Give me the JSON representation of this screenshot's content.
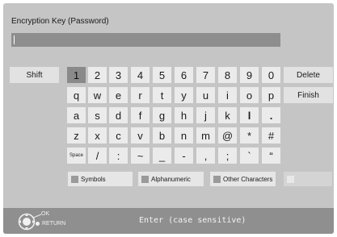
{
  "header": {
    "title": "Encryption Key (Password)"
  },
  "input": {
    "value": ""
  },
  "side_keys": {
    "shift": "Shift",
    "delete": "Delete",
    "finish": "Finish"
  },
  "keyboard": {
    "rows": [
      [
        "1",
        "2",
        "3",
        "4",
        "5",
        "6",
        "7",
        "8",
        "9",
        "0"
      ],
      [
        "q",
        "w",
        "e",
        "r",
        "t",
        "y",
        "u",
        "i",
        "o",
        "p"
      ],
      [
        "a",
        "s",
        "d",
        "f",
        "g",
        "h",
        "j",
        "k",
        "l",
        "."
      ],
      [
        "z",
        "x",
        "c",
        "v",
        "b",
        "n",
        "m",
        "@",
        "*",
        "#"
      ],
      [
        "Space",
        "/",
        ":",
        "~",
        "_",
        "-",
        ",",
        ";",
        "`",
        "“"
      ]
    ],
    "selected_key": "1"
  },
  "modes": [
    "Symbols",
    "Alphanumeric",
    "Other Characters",
    ""
  ],
  "footer": {
    "ok_label": "OK",
    "return_label": "RETURN",
    "hint": "Enter (case sensitive)"
  },
  "colors": {
    "screen_bg": "#c5c5c5",
    "key_bg": "#ebebeb",
    "selected_key_bg": "#8a8a8a",
    "footer_bg": "#8f8f8f"
  }
}
